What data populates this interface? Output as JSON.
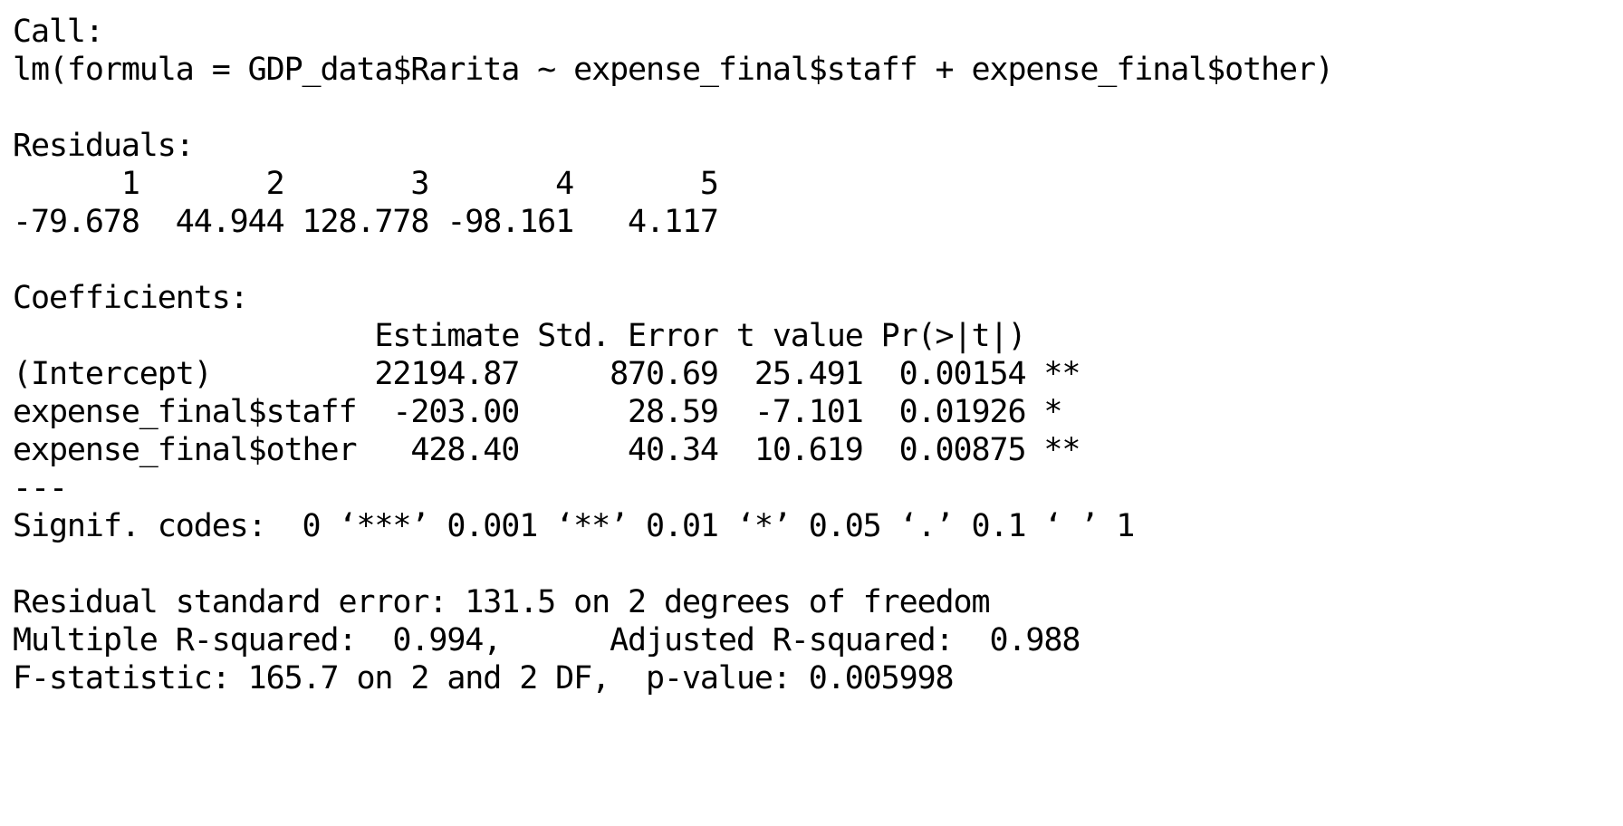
{
  "console": {
    "call_header": "Call:",
    "call_formula": "lm(formula = GDP_data$Rarita ~ expense_final$staff + expense_final$other)",
    "residuals_header": "Residuals:",
    "residuals_indices": "      1       2       3       4       5",
    "residuals_values": "-79.678  44.944 128.778 -98.161   4.117",
    "coefficients_header": "Coefficients:",
    "coef_table_header": "                    Estimate Std. Error t value Pr(>|t|)",
    "coef_rows": [
      "(Intercept)         22194.87     870.69  25.491  0.00154 **",
      "expense_final$staff  -203.00      28.59  -7.101  0.01926 *",
      "expense_final$other   428.40      40.34  10.619  0.00875 **"
    ],
    "separator": "---",
    "signif_codes": "Signif. codes:  0 ‘***’ 0.001 ‘**’ 0.01 ‘*’ 0.05 ‘.’ 0.1 ‘ ’ 1",
    "residual_se": "Residual standard error: 131.5 on 2 degrees of freedom",
    "r_squared": "Multiple R-squared:  0.994,\tAdjusted R-squared:  0.988 ",
    "f_statistic": "F-statistic: 165.7 on 2 and 2 DF,  p-value: 0.005998"
  }
}
